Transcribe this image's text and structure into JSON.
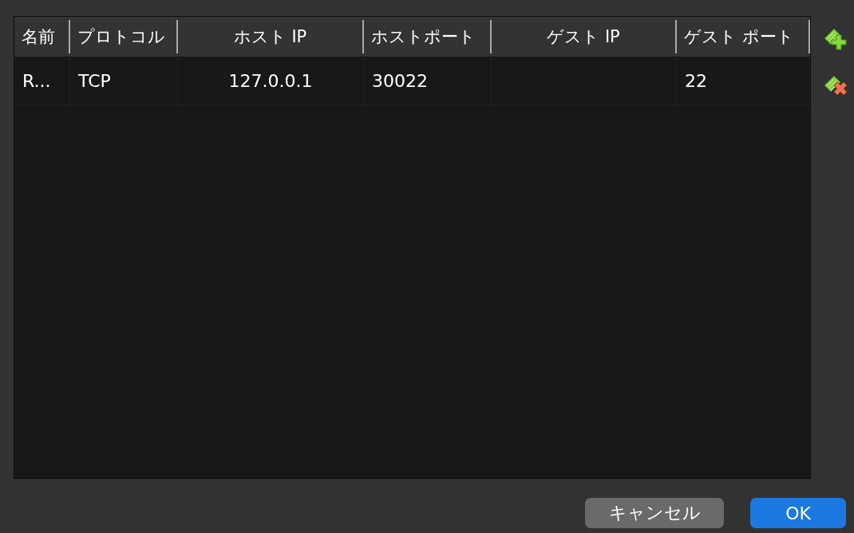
{
  "table": {
    "columns": [
      {
        "label": "名前"
      },
      {
        "label": "プロトコル"
      },
      {
        "label": "ホスト IP"
      },
      {
        "label": "ホストポート"
      },
      {
        "label": "ゲスト IP"
      },
      {
        "label": "ゲスト ポート"
      }
    ],
    "rows": [
      {
        "cells": [
          "R...",
          "TCP",
          "127.0.0.1",
          "30022",
          "",
          "22"
        ]
      }
    ]
  },
  "side_buttons": [
    {
      "kind": "add"
    },
    {
      "kind": "remove"
    }
  ],
  "buttons": [
    {
      "label": "キャンセル",
      "kind": "secondary"
    },
    {
      "label": "OK",
      "kind": "primary"
    }
  ]
}
